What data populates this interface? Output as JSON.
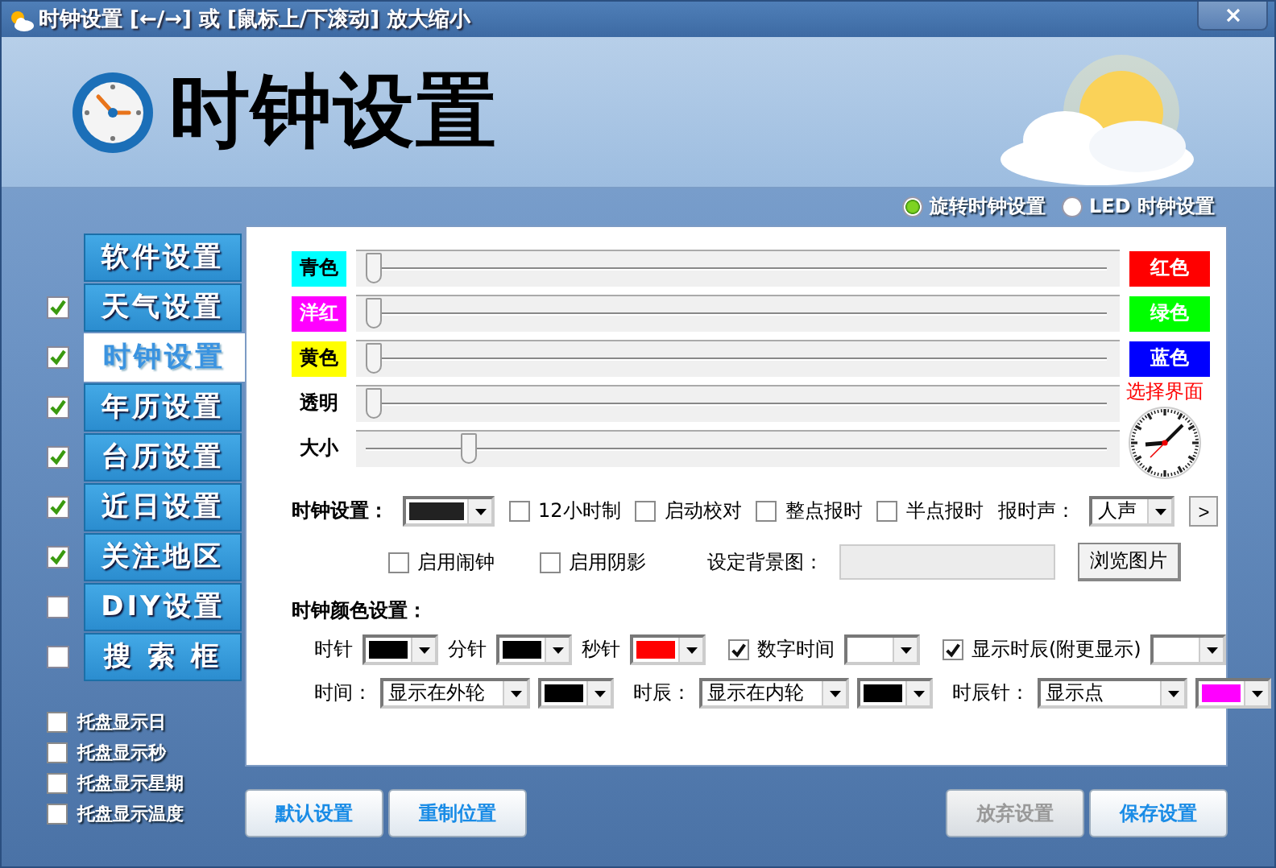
{
  "window": {
    "title": "时钟设置 [←/→] 或 [鼠标上/下滚动] 放大缩小"
  },
  "header": {
    "title": "时钟设置"
  },
  "clock_modes": [
    {
      "label": "旋转时钟设置",
      "selected": true
    },
    {
      "label": "LED 时钟设置",
      "selected": false
    }
  ],
  "sidebar": {
    "items": [
      {
        "label": "软件设置",
        "kind": "plain",
        "selected": false
      },
      {
        "label": "天气设置",
        "kind": "toggle",
        "checked": true,
        "selected": false
      },
      {
        "label": "时钟设置",
        "kind": "toggle",
        "checked": true,
        "selected": true
      },
      {
        "label": "年历设置",
        "kind": "toggle",
        "checked": true,
        "selected": false
      },
      {
        "label": "台历设置",
        "kind": "toggle",
        "checked": true,
        "selected": false
      },
      {
        "label": "近日设置",
        "kind": "toggle",
        "checked": true,
        "selected": false
      },
      {
        "label": "关注地区",
        "kind": "toggle",
        "checked": true,
        "selected": false
      },
      {
        "label": "DIY设置",
        "kind": "toggle",
        "checked": false,
        "selected": false
      },
      {
        "label": "搜 索 框",
        "kind": "toggle",
        "checked": false,
        "selected": false
      }
    ]
  },
  "tray_options": [
    {
      "label": "托盘显示日",
      "checked": false
    },
    {
      "label": "托盘显示秒",
      "checked": false
    },
    {
      "label": "托盘显示星期",
      "checked": false
    },
    {
      "label": "托盘显示温度",
      "checked": false
    }
  ],
  "sliders": [
    {
      "kind": "channel",
      "label": "青色",
      "color": "#00ffff",
      "level": 0,
      "end": {
        "label": "红色",
        "color": "#ff0000"
      }
    },
    {
      "kind": "channel",
      "label": "洋红",
      "color": "#ff00ff",
      "level": 0,
      "end": {
        "label": "绿色",
        "color": "#00ff00"
      }
    },
    {
      "kind": "channel",
      "label": "黄色",
      "color": "#ffff00",
      "level": 0,
      "end": {
        "label": "蓝色",
        "color": "#0000ff"
      }
    },
    {
      "kind": "plain",
      "label": "透明",
      "level": 0
    },
    {
      "kind": "plain",
      "label": "大小",
      "level": 0.13
    }
  ],
  "preview": {
    "label": "选择界面"
  },
  "clock_options": {
    "label": "时钟设置：",
    "style": {
      "color": "#222222"
    },
    "checks": [
      {
        "label": "12小时制",
        "checked": false
      },
      {
        "label": "启动校对",
        "checked": false
      },
      {
        "label": "整点报时",
        "checked": false
      },
      {
        "label": "半点报时",
        "checked": false
      }
    ],
    "sound_label": "报时声：",
    "sound_value": "人声",
    "next_button": ">"
  },
  "extra_checks": [
    {
      "label": "启用闹钟",
      "checked": false
    },
    {
      "label": "启用阴影",
      "checked": false
    }
  ],
  "background": {
    "label": "设定背景图：",
    "button": "浏览图片"
  },
  "colors": {
    "title": "时钟颜色设置：",
    "hands": [
      {
        "kind": "color",
        "label": "时针",
        "color": "#000000"
      },
      {
        "kind": "color",
        "label": "分针",
        "color": "#000000"
      },
      {
        "kind": "color",
        "label": "秒针",
        "color": "#ff0000"
      },
      {
        "kind": "check",
        "label": "数字时间",
        "checked": true,
        "color": "#ffffff"
      },
      {
        "kind": "check",
        "label": "显示时辰(附更显示)",
        "checked": true,
        "color": "#ffffff"
      }
    ],
    "display": [
      {
        "label": "时间：",
        "value": "显示在外轮",
        "color": "#000000"
      },
      {
        "label": "时辰：",
        "value": "显示在内轮",
        "color": "#000000"
      },
      {
        "label": "时辰针：",
        "value": "显示点",
        "color": "#ff00ff"
      }
    ]
  },
  "buttons_left": [
    {
      "label": "默认设置",
      "disabled": false
    },
    {
      "label": "重制位置",
      "disabled": false
    }
  ],
  "buttons_right": [
    {
      "label": "放弃设置",
      "disabled": true
    },
    {
      "label": "保存设置",
      "disabled": false
    }
  ]
}
